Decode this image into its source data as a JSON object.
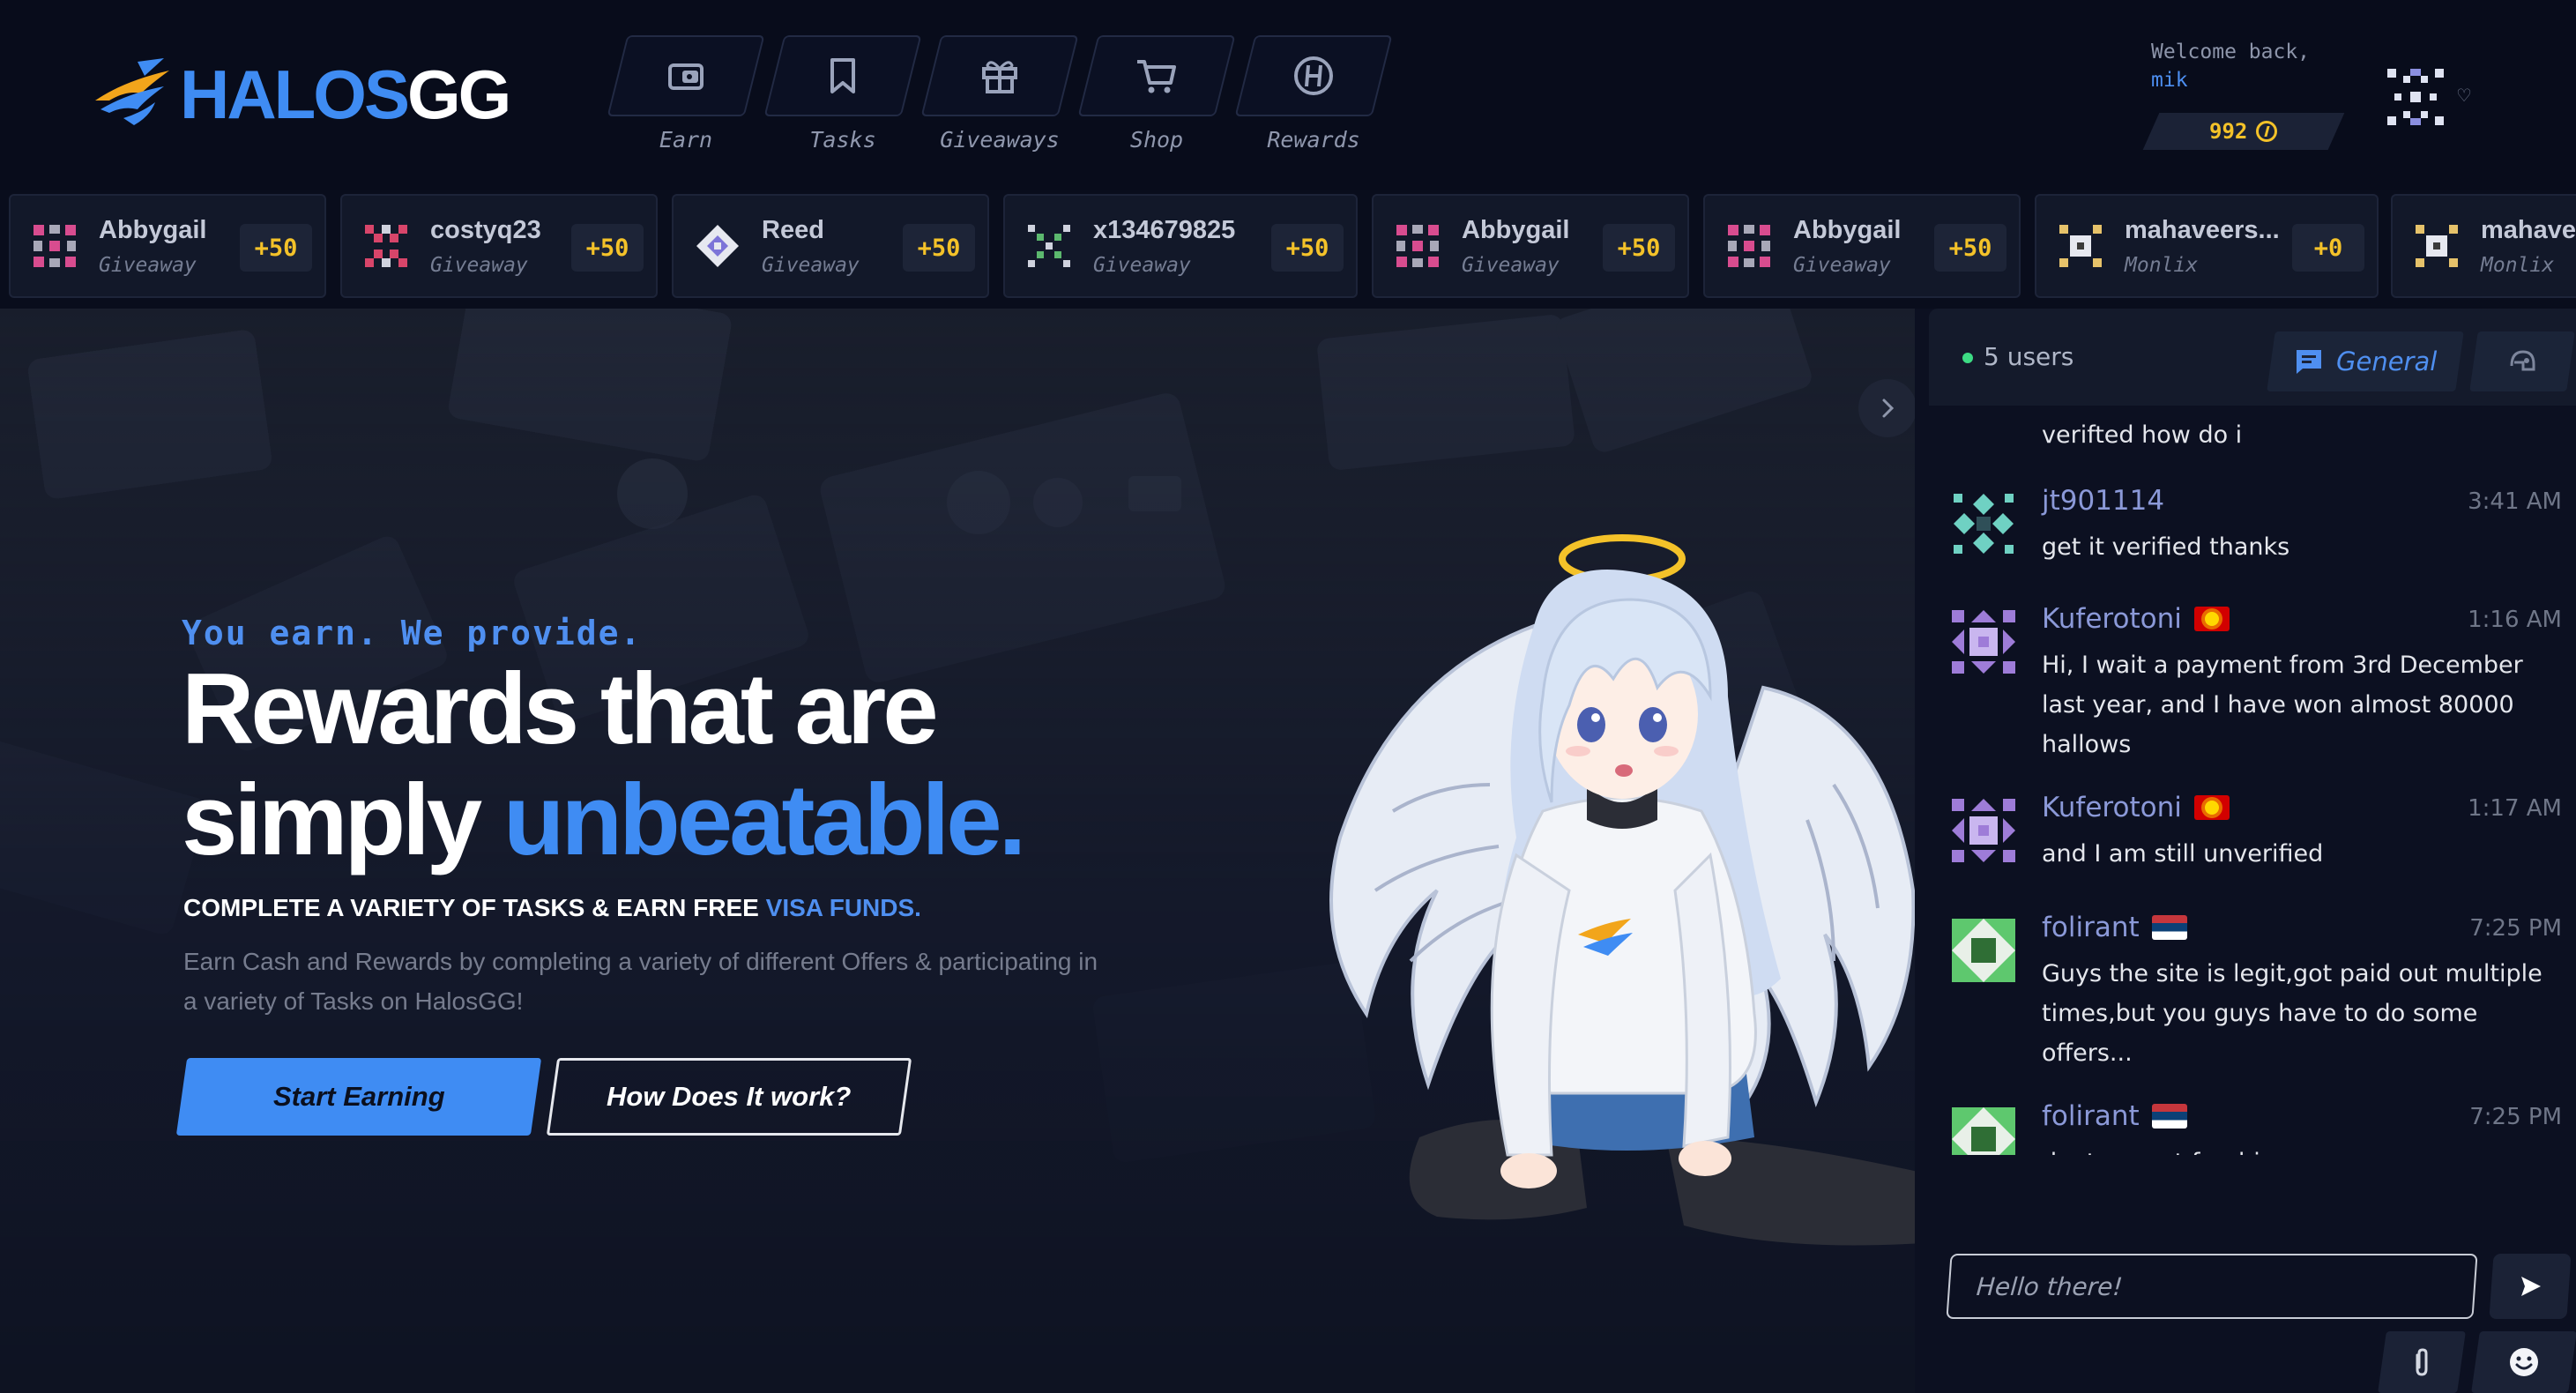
{
  "brand": {
    "logo_main": "HALOS",
    "logo_suffix": "GG"
  },
  "nav": [
    {
      "label": "Earn",
      "icon": "wallet-icon"
    },
    {
      "label": "Tasks",
      "icon": "bookmark-icon"
    },
    {
      "label": "Giveaways",
      "icon": "gift-icon"
    },
    {
      "label": "Shop",
      "icon": "cart-icon"
    },
    {
      "label": "Rewards",
      "icon": "halo-coin-icon"
    }
  ],
  "user": {
    "welcome": "Welcome back,",
    "name": "mik",
    "balance": "992"
  },
  "ticker": [
    {
      "name": "Abbygail",
      "type": "Giveaway",
      "amount": "+50",
      "color": "#d84c8f"
    },
    {
      "name": "costyq23",
      "type": "Giveaway",
      "amount": "+50",
      "color": "#d8456a"
    },
    {
      "name": "Reed",
      "type": "Giveaway",
      "amount": "+50",
      "color": "#7c74d8"
    },
    {
      "name": "x134679825",
      "type": "Giveaway",
      "amount": "+50",
      "color": "#5cb86e"
    },
    {
      "name": "Abbygail",
      "type": "Giveaway",
      "amount": "+50",
      "color": "#d84c8f"
    },
    {
      "name": "Abbygail",
      "type": "Giveaway",
      "amount": "+50",
      "color": "#d84c8f"
    },
    {
      "name": "mahaveers...",
      "type": "Monlix",
      "amount": "+0",
      "color": "#e6c26a"
    },
    {
      "name": "mahavee",
      "type": "Monlix",
      "amount": "",
      "color": "#e6c26a"
    }
  ],
  "hero": {
    "eyebrow": "You earn. We provide.",
    "title_line1": "Rewards that are",
    "title_line2_plain": "simply ",
    "title_line2_accent": "unbeatable.",
    "subhead_plain": "COMPLETE A VARIETY OF TASKS & EARN FREE ",
    "subhead_accent": "VISA FUNDS.",
    "description": "Earn Cash and Rewards by completing a variety of different Offers & participating in a variety of Tasks on HalosGG!",
    "primary_button": "Start Earning",
    "secondary_button": "How Does It work?"
  },
  "chat": {
    "online": "5 users",
    "channel": "General",
    "clipped_text": "verifted how do i",
    "messages": [
      {
        "user": "jt901114",
        "time": "3:41 AM",
        "text": "get it verified thanks",
        "flag": "",
        "color": "#6fd1c3"
      },
      {
        "user": "Kuferotoni",
        "time": "1:16 AM",
        "text": "Hi, I wait a payment from 3rd December last year, and I have won almost 80000 hallows",
        "flag": "mk",
        "color": "#9e7cd8"
      },
      {
        "user": "Kuferotoni",
        "time": "1:17 AM",
        "text": "and I am still unverified",
        "flag": "mk",
        "color": "#9e7cd8"
      },
      {
        "user": "folirant",
        "time": "7:25 PM",
        "text": "Guys the site is legit,got paid out multiple times,but you guys have to do some offers...",
        "flag": "rs",
        "color": "#5ec86e"
      },
      {
        "user": "folirant",
        "time": "7:25 PM",
        "text": "dont expect freebies",
        "flag": "rs",
        "color": "#5ec86e"
      }
    ],
    "input_placeholder": "Hello there!"
  }
}
